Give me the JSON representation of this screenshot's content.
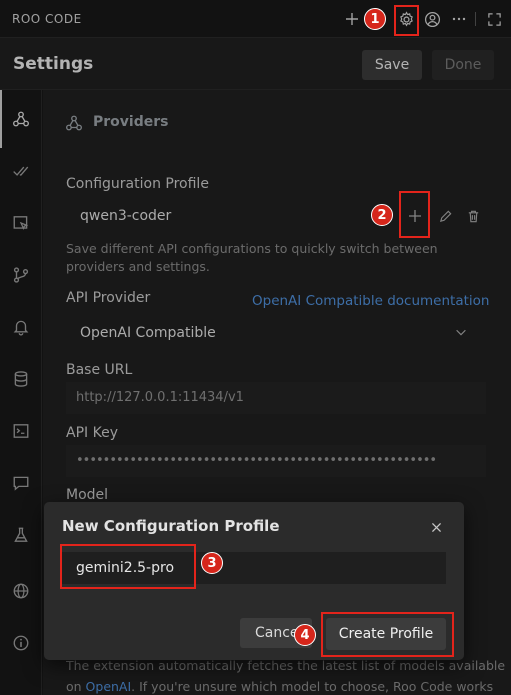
{
  "app_title": "ROO CODE",
  "header": {
    "title": "Settings",
    "save_label": "Save",
    "done_label": "Done"
  },
  "section": {
    "title": "Providers"
  },
  "config_profile": {
    "label": "Configuration Profile",
    "value": "qwen3-coder",
    "description": "Save different API configurations to quickly switch between providers and settings."
  },
  "api_provider": {
    "label": "API Provider",
    "doc_link": "OpenAI Compatible documentation",
    "value": "OpenAI Compatible"
  },
  "base_url": {
    "label": "Base URL",
    "value": "http://127.0.0.1:11434/v1"
  },
  "api_key": {
    "label": "API Key",
    "masked": "••••••••••••••••••••••••••••••••••••••••••••••••••••••"
  },
  "model": {
    "label": "Model"
  },
  "bottom_text": {
    "line1": "The extension automatically fetches the latest list of models available",
    "line2_prefix": "on ",
    "line2_link": "OpenAI",
    "line2_suffix": ". If you're unsure which model to choose, Roo Code works"
  },
  "dialog": {
    "title": "New Configuration Profile",
    "input_value": "gemini2.5-pro",
    "cancel_label": "Cancel",
    "create_label": "Create Profile"
  },
  "annotations": [
    "1",
    "2",
    "3",
    "4"
  ],
  "colors": {
    "highlight": "#e3241b",
    "badge": "#d6261b",
    "link": "#4f8dd6",
    "background": "#1f1f1f"
  },
  "icons": {
    "toolbar": [
      "plus-icon",
      "history-icon",
      "gear-icon",
      "account-icon",
      "more-icon",
      "fullscreen-icon"
    ],
    "rail": [
      "providers-icon",
      "auto-approve-icon",
      "browser-icon",
      "checkpoints-icon",
      "notifications-icon",
      "context-icon",
      "terminal-icon",
      "prompts-icon",
      "experimental-icon",
      "language-icon",
      "about-icon"
    ]
  }
}
